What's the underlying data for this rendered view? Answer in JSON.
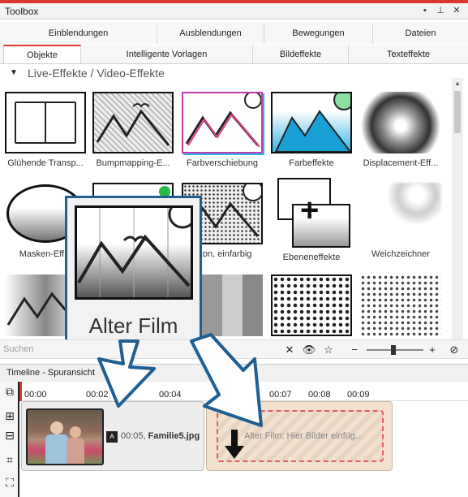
{
  "window": {
    "title": "Toolbox"
  },
  "tabs_row1": [
    {
      "label": "Einblendungen"
    },
    {
      "label": "Ausblendungen"
    },
    {
      "label": "Bewegungen"
    },
    {
      "label": "Dateien"
    }
  ],
  "tabs_row2": [
    {
      "label": "Objekte",
      "active": true
    },
    {
      "label": "Intelligente Vorlagen"
    },
    {
      "label": "Bildeffekte"
    },
    {
      "label": "Texteffekte"
    }
  ],
  "section": {
    "label": "Live-Effekte / Video-Effekte"
  },
  "effects": [
    {
      "label": "Glühende Transp..."
    },
    {
      "label": "Bumpmapping-E..."
    },
    {
      "label": "Farbverschiebung"
    },
    {
      "label": "Farbeffekte"
    },
    {
      "label": "Displacement-Eff..."
    },
    {
      "label": "Masken-Eff..."
    },
    {
      "label": ""
    },
    {
      "label": "...ton, einfarbig"
    },
    {
      "label": "Ebeneneffekte"
    },
    {
      "label": "Weichzeichner"
    }
  ],
  "hover_card": {
    "label": "Alter Film"
  },
  "search": {
    "placeholder": "Suchen"
  },
  "timeline": {
    "title": "Timeline - Spuransicht",
    "ticks": [
      "00:00",
      "00:02",
      "00:04",
      "00:07",
      "00:08",
      "00:09"
    ],
    "clip1": {
      "duration": "00:05,",
      "filename": "Familie5.jpg"
    },
    "clip2": {
      "text": "Alter Film: Hier Bilder einfüg..."
    }
  },
  "colors": {
    "accent": "#d9392c",
    "highlight": "#1f5f91"
  }
}
